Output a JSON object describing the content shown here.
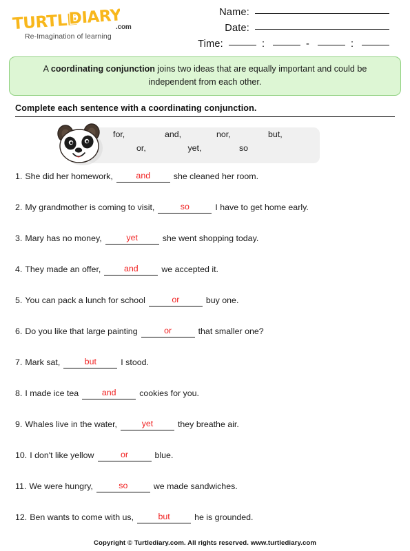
{
  "header": {
    "logo": {
      "text": "TURTLE DIARY",
      "word1": "TURTLE",
      "word2": "DIARY",
      "dotcom": ".com",
      "tagline": "Re-Imagination of learning",
      "color": "#f8b71c",
      "outline": "#ffffff"
    },
    "fields": {
      "name_label": "Name:",
      "date_label": "Date:",
      "time_label": "Time:",
      "time_sep1": ":",
      "time_sep2": "-",
      "time_sep3": ":"
    }
  },
  "banner": {
    "lead": "A ",
    "term": "coordinating conjunction",
    "rest": " joins two ideas that are equally important and could be independent from each other.",
    "bg_color": "#ddf6d4",
    "border_color": "#8ed07e"
  },
  "instruction": "Complete each sentence with a coordinating conjunction.",
  "wordbank": {
    "row1": [
      "for,",
      "and,",
      "nor,",
      "but,"
    ],
    "row2": [
      "or,",
      "yet,",
      "so"
    ],
    "bg_color": "#f0f0f0",
    "mascot": "panda-face-icon"
  },
  "answer_color": "#f02020",
  "questions": [
    {
      "num": "1.",
      "pre": "She did her homework,",
      "answer": "and",
      "post": "she cleaned her room."
    },
    {
      "num": "2.",
      "pre": "My grandmother is coming to visit,",
      "answer": "so",
      "post": "I have to get home early."
    },
    {
      "num": "3.",
      "pre": "Mary has no money,",
      "answer": "yet",
      "post": "she went shopping today."
    },
    {
      "num": "4.",
      "pre": "They made an offer,",
      "answer": "and",
      "post": "we accepted it."
    },
    {
      "num": "5.",
      "pre": "You can pack a lunch for school",
      "answer": "or",
      "post": "buy one."
    },
    {
      "num": "6.",
      "pre": "Do you like that large painting",
      "answer": "or",
      "post": "that smaller one?"
    },
    {
      "num": "7.",
      "pre": "Mark sat,",
      "answer": "but",
      "post": "I stood."
    },
    {
      "num": "8.",
      "pre": "I made ice tea",
      "answer": "and",
      "post": "cookies for you."
    },
    {
      "num": "9.",
      "pre": "Whales live in the water,",
      "answer": "yet",
      "post": "they breathe air."
    },
    {
      "num": "10.",
      "pre": "I don't like yellow",
      "answer": "or",
      "post": "blue."
    },
    {
      "num": "11.",
      "pre": "We were hungry,",
      "answer": "so",
      "post": "we made sandwiches."
    },
    {
      "num": "12.",
      "pre": "Ben wants to come with us,",
      "answer": "but",
      "post": "he is grounded."
    }
  ],
  "footer": "Copyright © Turtlediary.com. All rights reserved. www.turtlediary.com"
}
